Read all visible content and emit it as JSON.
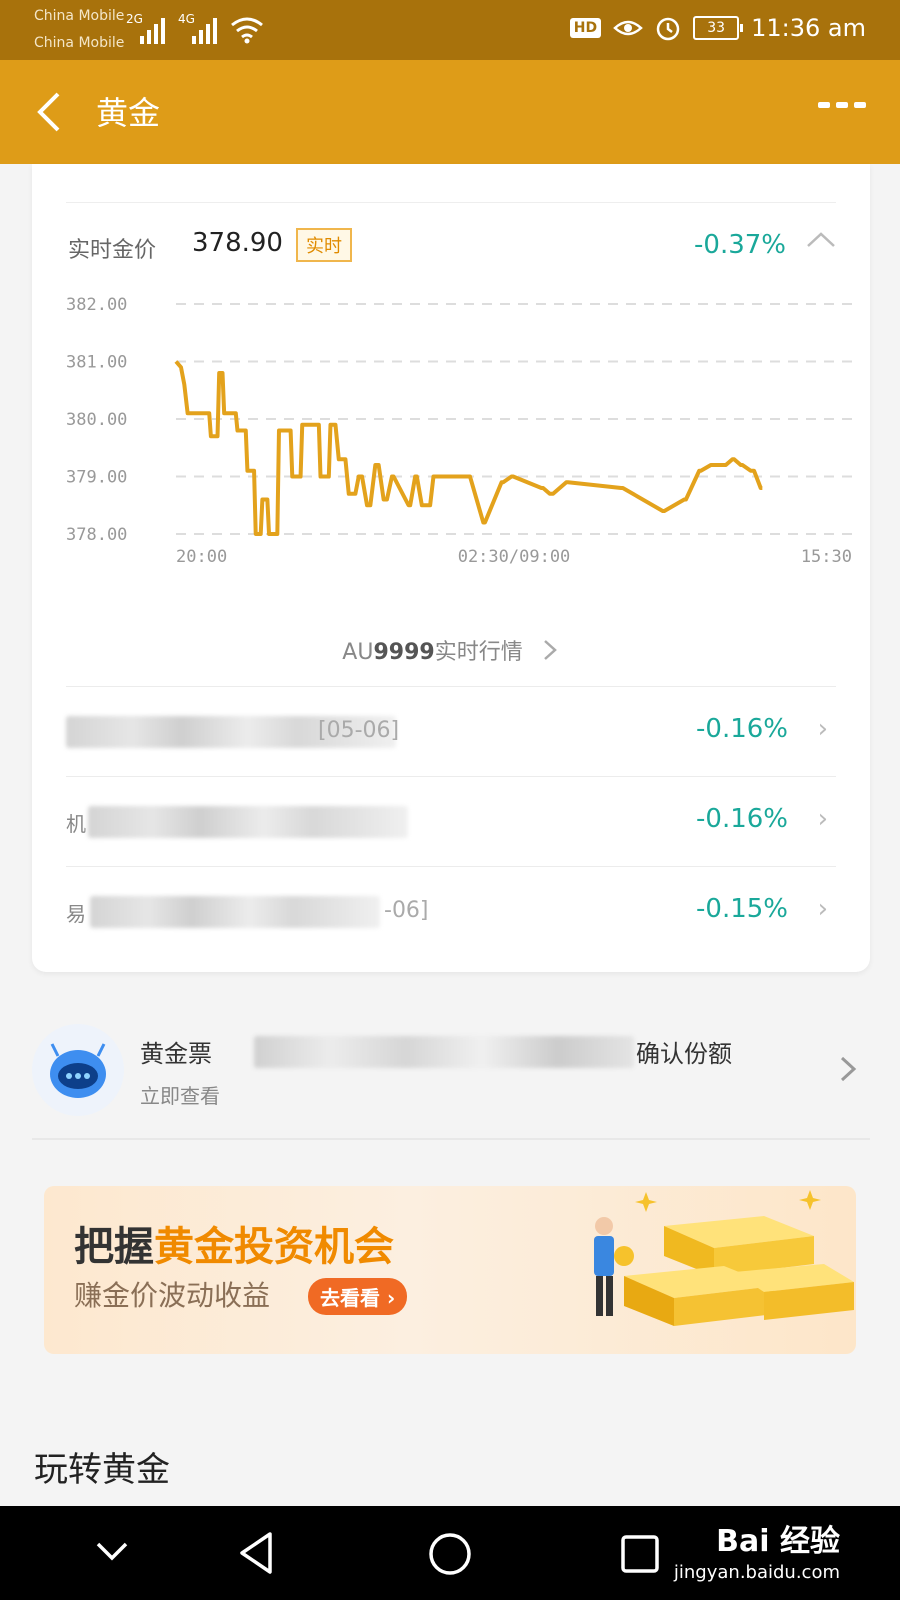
{
  "status_bar": {
    "carrier1": "China Mobile",
    "carrier2": "China Mobile",
    "network1": "2G",
    "network2": "4G",
    "hd": "HD",
    "battery": "33",
    "time": "11:36 am"
  },
  "header": {
    "back_icon": "chevron-left-icon",
    "title": "黄金",
    "more_icon": "more-dots-icon"
  },
  "price": {
    "label": "实时金价",
    "value": "378.90",
    "tag": "实时",
    "change": "-0.37%"
  },
  "chart_data": {
    "type": "line",
    "title": "",
    "xlabel": "",
    "ylabel": "",
    "ylim": [
      378.0,
      382.0
    ],
    "y_ticks": [
      "382.00",
      "381.00",
      "380.00",
      "379.00",
      "378.00"
    ],
    "x_ticks": [
      "20:00",
      "02:30/09:00",
      "15:30"
    ],
    "color": "#e3a21c",
    "grid": "dashed horizontal",
    "series": [
      {
        "x": [
          0,
          0.6,
          1.0,
          1.4,
          1.6,
          4.0,
          4.2,
          5.0,
          5.2,
          5.6,
          5.8,
          7.2,
          7.4,
          8.4,
          8.6,
          9.4,
          9.6,
          10.2,
          10.4,
          11.0,
          11.2,
          12.2,
          12.4,
          13.8,
          14.0,
          15.0,
          15.2,
          17.2,
          17.4,
          18.4,
          18.6,
          19.2,
          19.6,
          20.4,
          20.8,
          21.2,
          21.6,
          22.0,
          22.4,
          23.0,
          23.4,
          24.0,
          24.4,
          25.0,
          25.4,
          26.0,
          26.2,
          28.0,
          28.2,
          28.8,
          29.0,
          29.6,
          30.0,
          30.6,
          31.0,
          32.4,
          32.6,
          35.2,
          35.4,
          37.0,
          37.2,
          39.2,
          39.4,
          40.4,
          40.6,
          44.0,
          44.2,
          45.0,
          45.4,
          47.0,
          47.2,
          53.6,
          53.8,
          58.6,
          58.8,
          61.2,
          61.4,
          63.0,
          63.2,
          64.4,
          64.6,
          66.0,
          66.2,
          67.0,
          67.2,
          68.0,
          68.2,
          69.2,
          69.6,
          70.4,
          70.6
        ],
        "y": [
          381.0,
          380.9,
          380.6,
          380.1,
          380.1,
          380.1,
          379.7,
          379.7,
          380.8,
          380.8,
          380.1,
          380.1,
          379.8,
          379.8,
          379.1,
          379.1,
          378.0,
          378.0,
          378.6,
          378.6,
          378.0,
          378.0,
          379.8,
          379.8,
          379.0,
          379.0,
          379.9,
          379.9,
          379.0,
          379.0,
          379.9,
          379.9,
          379.3,
          379.3,
          378.7,
          378.7,
          378.7,
          379.0,
          379.0,
          378.5,
          378.5,
          379.2,
          379.2,
          378.6,
          378.6,
          379.0,
          379.0,
          378.5,
          378.5,
          379.0,
          379.0,
          378.5,
          378.5,
          378.5,
          379.0,
          379.0,
          379.0,
          379.0,
          379.0,
          378.2,
          378.2,
          378.9,
          378.9,
          379.0,
          379.0,
          378.8,
          378.8,
          378.7,
          378.7,
          378.9,
          378.9,
          378.8,
          378.8,
          378.4,
          378.4,
          378.6,
          378.6,
          379.1,
          379.1,
          379.2,
          379.2,
          379.2,
          379.2,
          379.3,
          379.3,
          379.2,
          379.2,
          379.1,
          379.1,
          378.8,
          378.8
        ]
      }
    ]
  },
  "chart_link": {
    "prefix": "AU",
    "code": "9999",
    "suffix": "实时行情",
    "chevron_icon": "chevron-right-icon"
  },
  "quotes": [
    {
      "tail": "[05-06]",
      "change": "-0.16%"
    },
    {
      "lead": "机",
      "change": "-0.16%"
    },
    {
      "lead": "易",
      "tail": "-06]",
      "change": "-0.15%"
    }
  ],
  "assistant": {
    "avatar_icon": "robot-avatar-icon",
    "title_start": "黄金票",
    "title_end": "确认份额",
    "subtitle": "立即查看"
  },
  "banner": {
    "headline_a": "把握",
    "headline_b": "黄金投资机会",
    "subline": "赚金价波动收益",
    "cta": "去看看"
  },
  "section_title": "玩转黄金",
  "nav": {
    "down_icon": "chevron-down-icon",
    "back_icon": "triangle-back-icon",
    "home_icon": "circle-home-icon",
    "recent_icon": "square-recent-icon"
  },
  "watermark": {
    "line1": "Bai 经验",
    "line2": "jingyan.baidu.com"
  }
}
